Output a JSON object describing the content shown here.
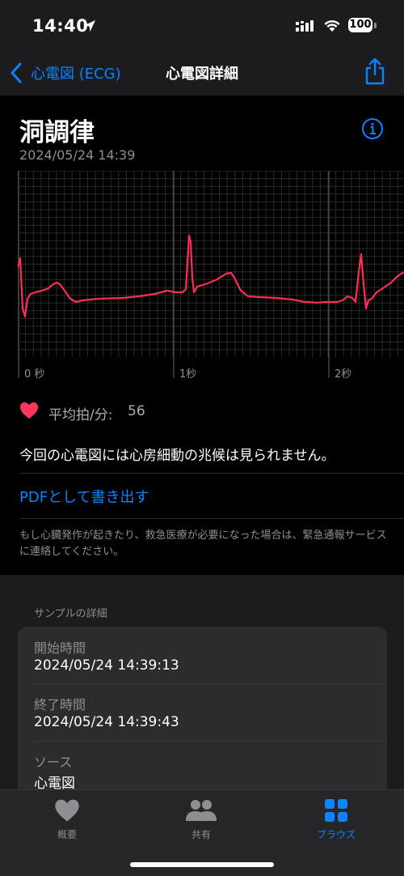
{
  "status_bar": {
    "time": "14:40",
    "battery": "100"
  },
  "nav": {
    "back_label": "心電図 (ECG)",
    "title": "心電図詳細"
  },
  "ecg": {
    "classification": "洞調律",
    "date": "2024/05/24 14:39",
    "time_labels": [
      "0 秒",
      "1秒",
      "2秒"
    ],
    "avg_hr_label": "平均拍/分:",
    "avg_hr_value": "56",
    "result_text": "今回の心電図には心房細動の兆候は見られません。",
    "pdf_label": "PDFとして書き出す",
    "disclaimer": "もし心臓発作が起きたり、救急医療が必要になった場合は、緊急通報サービスに連絡してください。",
    "trace_color": "#ff2d55"
  },
  "details": {
    "header": "サンプルの詳細",
    "rows": [
      {
        "label": "開始時間",
        "value": "2024/05/24 14:39:13"
      },
      {
        "label": "終了時間",
        "value": "2024/05/24 14:39:43"
      },
      {
        "label": "ソース",
        "value": "心電図"
      }
    ]
  },
  "tabs": [
    {
      "label": "概要",
      "icon": "heart-icon",
      "active": false
    },
    {
      "label": "共有",
      "icon": "people-icon",
      "active": false
    },
    {
      "label": "ブラウズ",
      "icon": "grid-icon",
      "active": true
    }
  ],
  "colors": {
    "accent": "#0a84ff",
    "heart": "#ff375f"
  }
}
